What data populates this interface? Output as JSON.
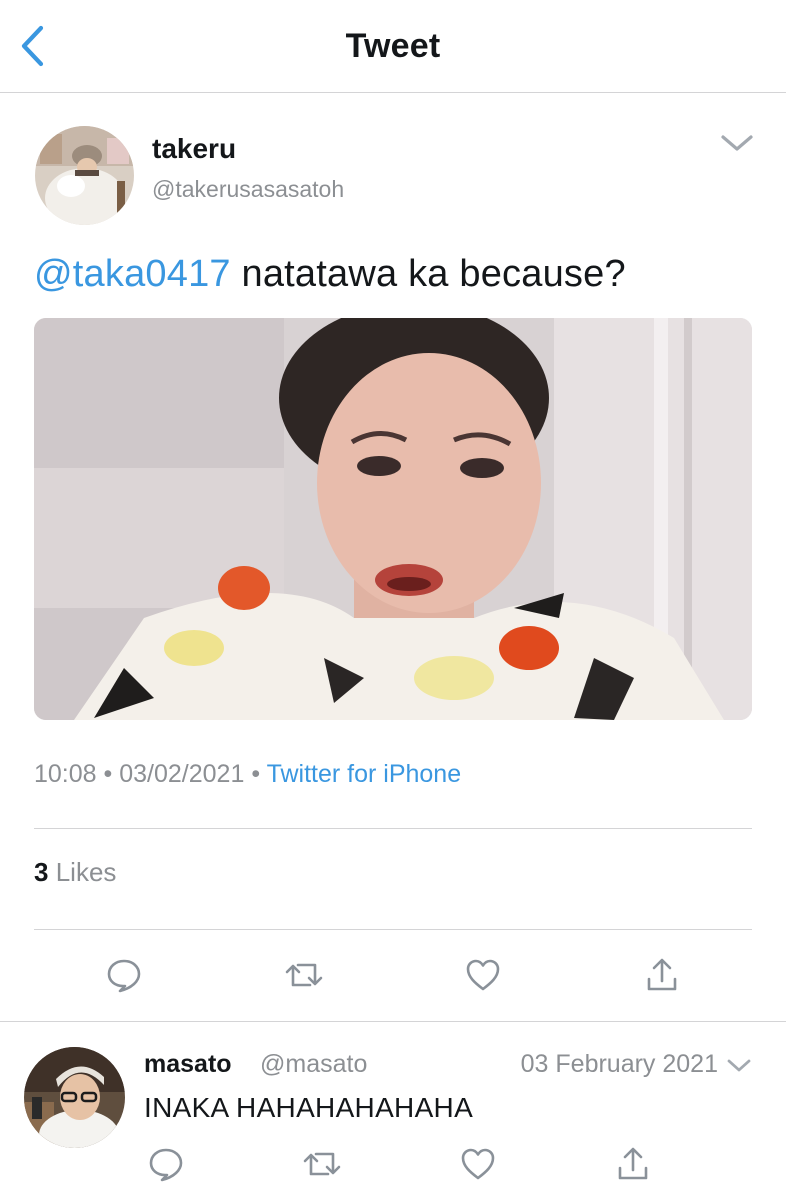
{
  "header": {
    "title": "Tweet",
    "back_icon": "chevron-left-icon"
  },
  "tweet": {
    "author_name": "takeru",
    "author_handle": "@takerusasasatoh",
    "mention": "@taka0417",
    "text": " natatawa ka because?",
    "media_alt": "reaction photo of a woman with a surprised, disgusted expression",
    "time": "10:08",
    "separator": "•",
    "date": "03/02/2021",
    "source": "Twitter for iPhone",
    "likes_count": "3",
    "likes_label": "Likes",
    "actions": [
      "reply-icon",
      "retweet-icon",
      "like-icon",
      "share-icon"
    ]
  },
  "reply": {
    "author_name": "masato",
    "author_handle": "@masato",
    "date": "03 February 2021",
    "text": "INAKA HAHAHAHAHAHA",
    "actions": [
      "reply-icon",
      "retweet-icon",
      "like-icon",
      "share-icon"
    ]
  },
  "colors": {
    "accent": "#3a97e0",
    "icon_gray": "#8a9199",
    "text_primary": "#14171a",
    "text_secondary": "#8c8f93",
    "divider": "#d4d4d6"
  }
}
